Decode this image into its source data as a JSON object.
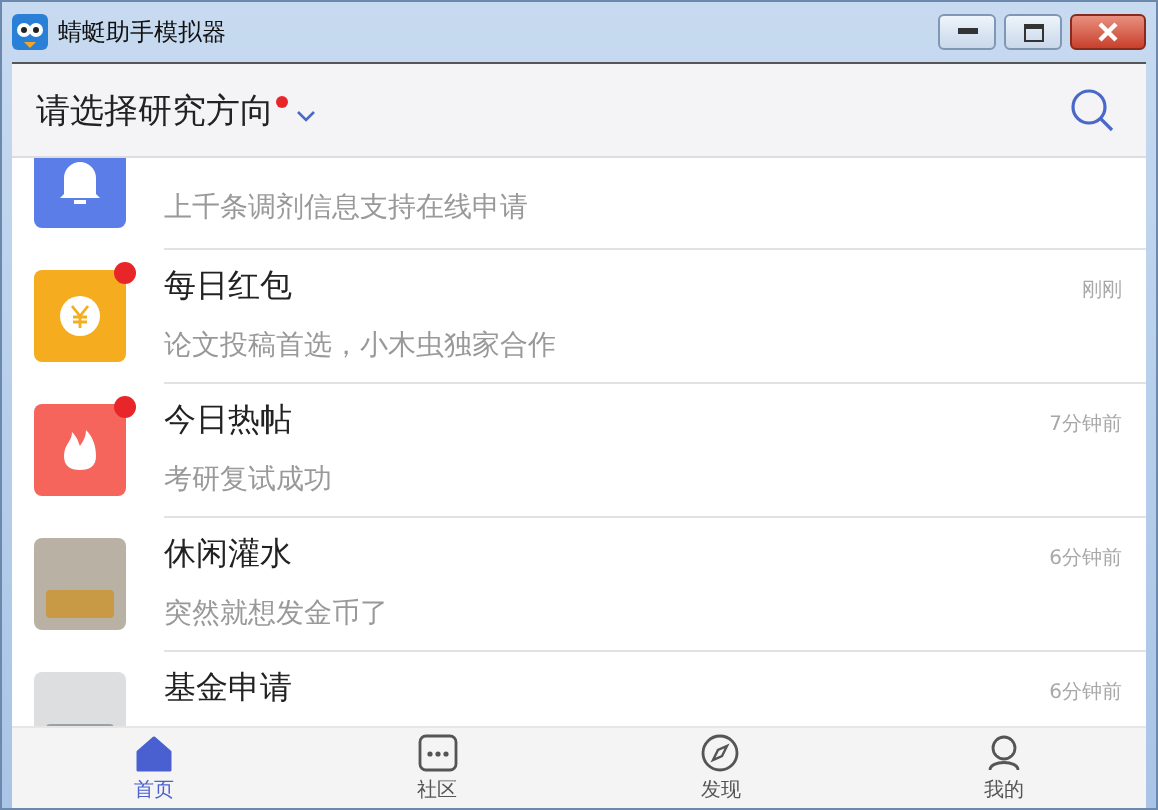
{
  "window": {
    "title": "蜻蜓助手模拟器"
  },
  "header": {
    "title": "请选择研究方向",
    "has_dot": true
  },
  "items": [
    {
      "kind": "bell",
      "subtitle": "上千条调剂信息支持在线申请",
      "unread": false
    },
    {
      "kind": "coin",
      "title": "每日红包",
      "subtitle": "论文投稿首选，小木虫独家合作",
      "time": "刚刚",
      "unread": true
    },
    {
      "kind": "flame",
      "title": "今日热帖",
      "subtitle": "考研复试成功",
      "time": "7分钟前",
      "unread": true
    },
    {
      "kind": "photo",
      "title": "休闲灌水",
      "subtitle": "突然就想发金币了",
      "time": "6分钟前",
      "unread": false
    },
    {
      "kind": "photo",
      "title": "基金申请",
      "time": "6分钟前",
      "unread": false
    }
  ],
  "tabs": [
    {
      "kind": "home",
      "label": "首页",
      "selected": true
    },
    {
      "kind": "community",
      "label": "社区",
      "selected": false
    },
    {
      "kind": "discover",
      "label": "发现",
      "selected": false
    },
    {
      "kind": "profile",
      "label": "我的",
      "selected": false
    }
  ]
}
